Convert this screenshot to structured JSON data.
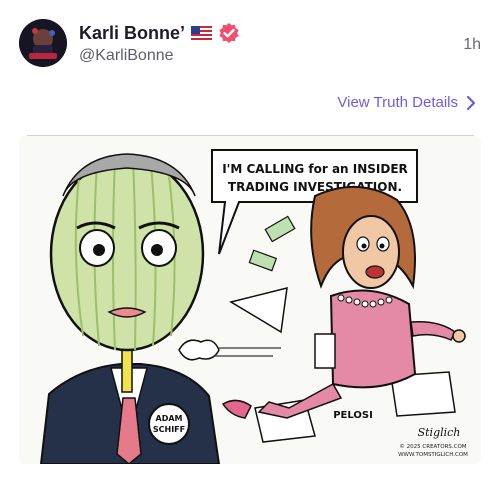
{
  "post": {
    "author": {
      "display_name": "Karli Bonne’",
      "handle": "@KarliBonne",
      "flag": "🇺🇸",
      "avatar_icon": "avatar-image",
      "verified_icon": "verified-badge-icon"
    },
    "timestamp": "1h",
    "details_link": {
      "label": "View Truth Details",
      "icon": "chevron-right-icon",
      "color": "#6f5be4"
    }
  },
  "cartoon": {
    "speech_bubble_line1": "I'M CALLING for an INSIDER",
    "speech_bubble_line2": "TRADING INVESTIGATION.",
    "badge_line1": "ADAM",
    "badge_line2": "SCHIFF",
    "label_pelosi": "PELOSI",
    "signature": "Stiglich",
    "credit_line1": "© 2025 CREATORS.COM",
    "credit_line2": "WWW.TOMSTIGLICH.COM"
  }
}
